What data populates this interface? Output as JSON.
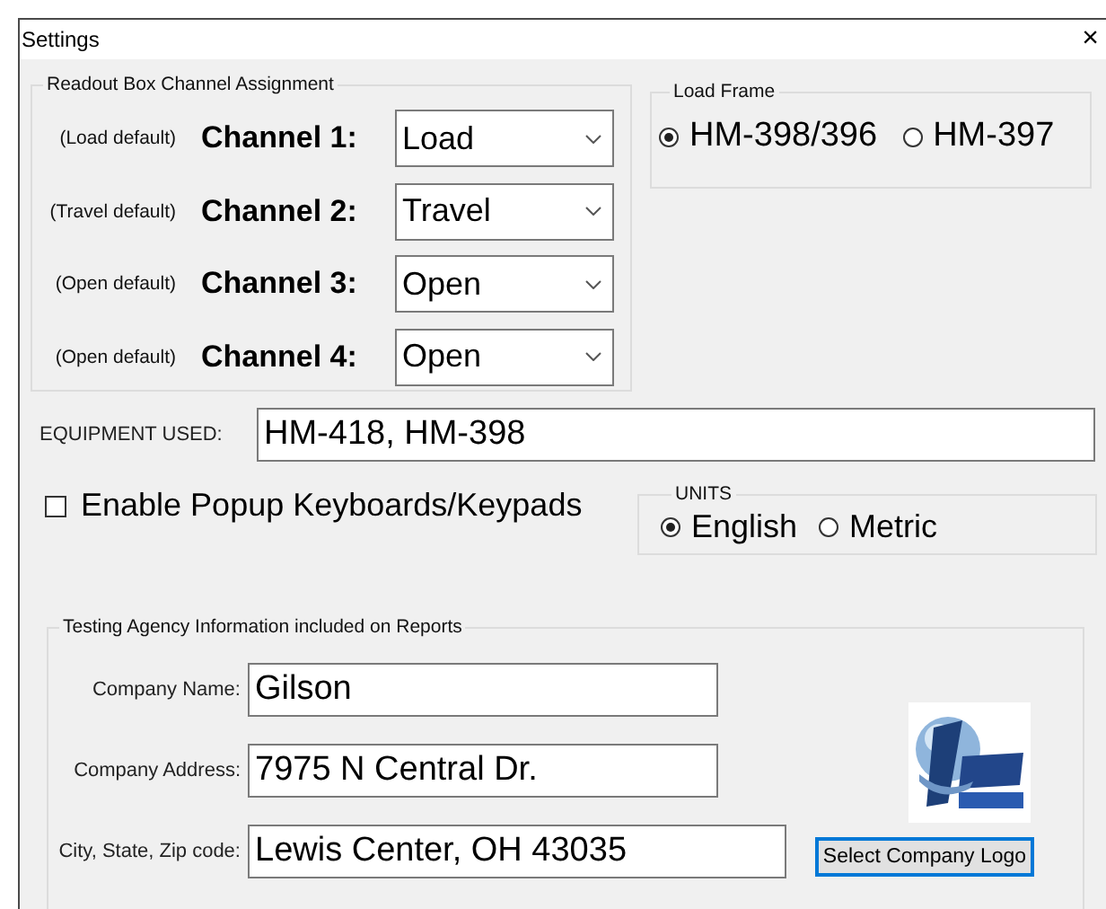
{
  "window": {
    "title": "Settings",
    "close": "×"
  },
  "channel_assignment": {
    "title": "Readout Box Channel Assignment",
    "rows": [
      {
        "default": "(Load default)",
        "label": "Channel 1:",
        "value": "Load"
      },
      {
        "default": "(Travel default)",
        "label": "Channel 2:",
        "value": "Travel"
      },
      {
        "default": "(Open default)",
        "label": "Channel 3:",
        "value": "Open"
      },
      {
        "default": "(Open default)",
        "label": "Channel 4:",
        "value": "Open"
      }
    ]
  },
  "load_frame": {
    "title": "Load Frame",
    "options": [
      {
        "label": "HM-398/396",
        "selected": true
      },
      {
        "label": "HM-397",
        "selected": false
      }
    ]
  },
  "equipment": {
    "label": "EQUIPMENT USED:",
    "value": "HM-418, HM-398"
  },
  "popup_keyboards": {
    "label": "Enable Popup Keyboards/Keypads",
    "checked": false
  },
  "units": {
    "title": "UNITS",
    "options": [
      {
        "label": "English",
        "selected": true
      },
      {
        "label": "Metric",
        "selected": false
      }
    ]
  },
  "agency": {
    "title": "Testing Agency Information included on Reports",
    "fields": [
      {
        "label": "Company Name:",
        "value": "Gilson"
      },
      {
        "label": "Company Address:",
        "value": "7975 N Central Dr."
      },
      {
        "label": "City, State, Zip code:",
        "value": "Lewis Center, OH 43035"
      }
    ],
    "button": "Select Company Logo"
  }
}
